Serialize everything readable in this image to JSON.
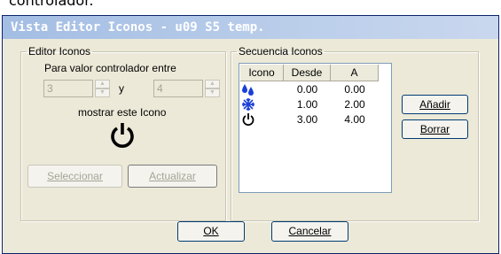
{
  "cropped_top_text": "controlador.",
  "window": {
    "title": "Vista Editor Iconos - u09 S5 temp."
  },
  "editor": {
    "legend": "Editor Iconos",
    "range_label": "Para valor controlador entre",
    "from_value": "3",
    "and_label": "y",
    "to_value": "4",
    "show_label": "mostrar este Icono",
    "icon": "power-icon",
    "select_label": "Seleccionar",
    "update_label": "Actualizar"
  },
  "sequence": {
    "legend": "Secuencia Iconos",
    "columns": [
      "Icono",
      "Desde",
      "A"
    ],
    "rows": [
      {
        "icon": "water-drops-icon",
        "from": "0.00",
        "to": "0.00"
      },
      {
        "icon": "snowflake-icon",
        "from": "1.00",
        "to": "2.00"
      },
      {
        "icon": "power-icon",
        "from": "3.00",
        "to": "4.00"
      }
    ],
    "add_label": "Añadir",
    "delete_label": "Borrar"
  },
  "footer": {
    "ok_label": "OK",
    "cancel_label": "Cancelar"
  },
  "colors": {
    "water": "#1a3fd6",
    "snow": "#1a3fd6",
    "power": "#000000"
  }
}
